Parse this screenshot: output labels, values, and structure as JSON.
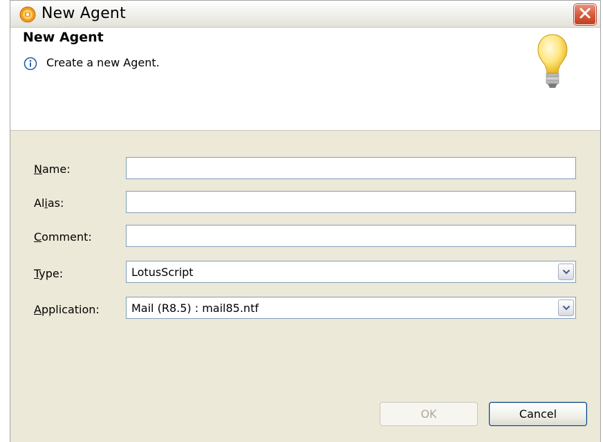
{
  "window": {
    "title": "New Agent",
    "close_tooltip": "Close"
  },
  "header": {
    "title": "New Agent",
    "message": "Create a new Agent."
  },
  "form": {
    "name": {
      "label_mnemonic": "N",
      "label_rest": "ame:",
      "value": ""
    },
    "alias": {
      "label_pre": "Al",
      "label_mnemonic": "i",
      "label_rest": "as:",
      "value": ""
    },
    "comment": {
      "label_mnemonic": "C",
      "label_rest": "omment:",
      "value": ""
    },
    "type": {
      "label_mnemonic": "T",
      "label_rest": "ype:",
      "value": "LotusScript"
    },
    "application": {
      "label_mnemonic": "A",
      "label_rest": "pplication:",
      "value": "Mail (R8.5) : mail85.ntf"
    }
  },
  "buttons": {
    "ok_label": "OK",
    "cancel_label": "Cancel"
  },
  "icons": {
    "app": "domino-designer-icon",
    "info": "info-icon",
    "wizard": "lightbulb-icon",
    "close": "close-icon",
    "dropdown": "chevron-down-icon"
  },
  "colors": {
    "dialog_bg": "#ece9d8",
    "field_border": "#7f9db9",
    "close_red": "#d75d3f"
  }
}
